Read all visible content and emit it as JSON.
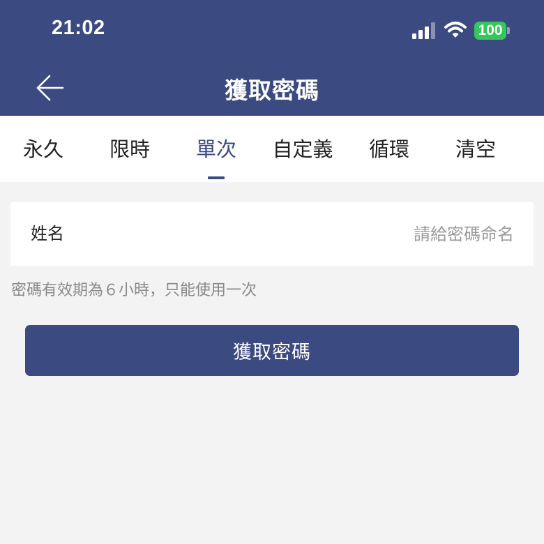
{
  "status_bar": {
    "time": "21:02",
    "battery": "100",
    "battery_color": "#34c759"
  },
  "header": {
    "title": "獲取密碼",
    "back_icon": "arrow-left-icon",
    "background": "#3b4a80"
  },
  "tabs": [
    {
      "label": "永久",
      "active": false
    },
    {
      "label": "限時",
      "active": false
    },
    {
      "label": "單次",
      "active": true
    },
    {
      "label": "自定義",
      "active": false
    },
    {
      "label": "循環",
      "active": false
    },
    {
      "label": "清空",
      "active": false
    }
  ],
  "form": {
    "name_label": "姓名",
    "name_value": "",
    "name_placeholder": "請給密碼命名"
  },
  "hint": "密碼有效期為６小時，只能使用一次",
  "submit_label": "獲取密碼",
  "accent_color": "#3b4a80"
}
